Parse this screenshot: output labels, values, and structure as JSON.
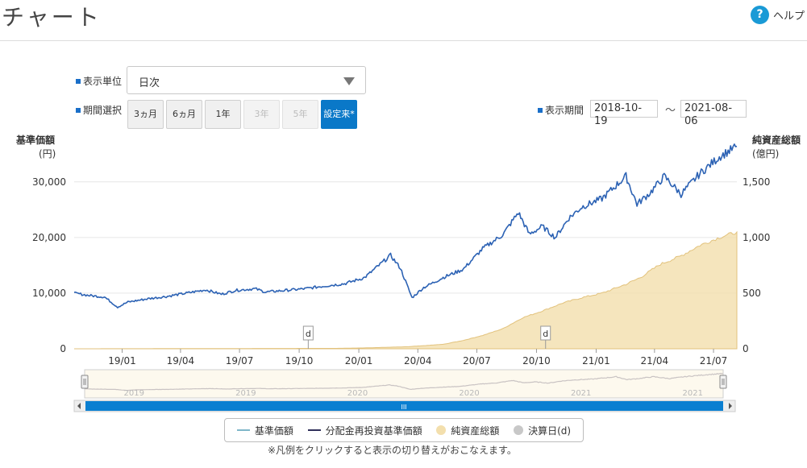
{
  "header": {
    "title": "チャート",
    "help_label": "ヘルプ",
    "help_icon": "question-icon"
  },
  "controls": {
    "unit_label": "表示単位",
    "unit_value": "日次",
    "period_label": "期間選択",
    "period_buttons": [
      {
        "label": "3ヵ月",
        "state": "enabled"
      },
      {
        "label": "6ヵ月",
        "state": "enabled"
      },
      {
        "label": "1年",
        "state": "enabled"
      },
      {
        "label": "3年",
        "state": "disabled"
      },
      {
        "label": "5年",
        "state": "disabled"
      },
      {
        "label": "設定来*",
        "state": "active"
      }
    ],
    "display_period_label": "表示期間",
    "date_from": "2018-10-19",
    "date_sep": "～",
    "date_to": "2021-08-06"
  },
  "axes": {
    "left_title": "基準価額",
    "left_unit": "(円)",
    "right_title": "純資産総額",
    "right_unit": "(億円)"
  },
  "chart_data": {
    "type": "line",
    "x_range": [
      "2018-10-19",
      "2021-08-06"
    ],
    "x_ticks": [
      "19/01",
      "19/04",
      "19/07",
      "19/10",
      "20/01",
      "20/04",
      "20/07",
      "20/10",
      "21/01",
      "21/04",
      "21/07"
    ],
    "y_left": {
      "ticks": [
        "0",
        "10,000",
        "20,000",
        "30,000"
      ],
      "range": [
        0,
        37500
      ]
    },
    "y_right": {
      "ticks": [
        "0",
        "500",
        "1,000",
        "1,500"
      ],
      "range": [
        0,
        1875
      ]
    },
    "grid": true,
    "series": [
      {
        "name": "基準価額",
        "axis": "left",
        "color": "#2c62b4",
        "points": [
          [
            "2018-10-19",
            10000
          ],
          [
            "2018-11-10",
            9600
          ],
          [
            "2018-12-05",
            9300
          ],
          [
            "2018-12-25",
            7500
          ],
          [
            "2019-01-10",
            8400
          ],
          [
            "2019-02-10",
            9000
          ],
          [
            "2019-03-10",
            9400
          ],
          [
            "2019-04-10",
            10000
          ],
          [
            "2019-05-10",
            10600
          ],
          [
            "2019-06-03",
            9800
          ],
          [
            "2019-06-25",
            10500
          ],
          [
            "2019-07-25",
            10800
          ],
          [
            "2019-08-10",
            10200
          ],
          [
            "2019-09-10",
            10500
          ],
          [
            "2019-10-10",
            10800
          ],
          [
            "2019-11-10",
            11300
          ],
          [
            "2019-12-10",
            11700
          ],
          [
            "2020-01-10",
            12800
          ],
          [
            "2020-02-19",
            16800
          ],
          [
            "2020-03-05",
            14500
          ],
          [
            "2020-03-23",
            9200
          ],
          [
            "2020-04-10",
            11000
          ],
          [
            "2020-05-10",
            12800
          ],
          [
            "2020-06-10",
            14300
          ],
          [
            "2020-07-10",
            18000
          ],
          [
            "2020-08-10",
            20500
          ],
          [
            "2020-09-03",
            24500
          ],
          [
            "2020-09-20",
            20600
          ],
          [
            "2020-10-10",
            22000
          ],
          [
            "2020-10-30",
            20000
          ],
          [
            "2020-11-20",
            23500
          ],
          [
            "2020-12-10",
            25500
          ],
          [
            "2021-01-10",
            27000
          ],
          [
            "2021-02-16",
            31000
          ],
          [
            "2021-03-05",
            26000
          ],
          [
            "2021-03-25",
            28000
          ],
          [
            "2021-04-16",
            31000
          ],
          [
            "2021-05-12",
            27800
          ],
          [
            "2021-06-10",
            31500
          ],
          [
            "2021-07-10",
            34500
          ],
          [
            "2021-08-06",
            36400
          ]
        ]
      },
      {
        "name": "分配金再投資基準価額",
        "axis": "left",
        "color": "#2f2f5a"
      },
      {
        "name": "純資産総額",
        "axis": "right",
        "type": "area",
        "color": "#f3dfad",
        "points": [
          [
            "2018-10-19",
            0
          ],
          [
            "2019-06-01",
            2
          ],
          [
            "2019-12-01",
            4
          ],
          [
            "2020-01-10",
            8
          ],
          [
            "2020-03-15",
            18
          ],
          [
            "2020-05-10",
            40
          ],
          [
            "2020-06-10",
            75
          ],
          [
            "2020-07-10",
            120
          ],
          [
            "2020-08-10",
            180
          ],
          [
            "2020-09-10",
            280
          ],
          [
            "2020-10-10",
            340
          ],
          [
            "2020-11-10",
            410
          ],
          [
            "2020-12-10",
            460
          ],
          [
            "2021-01-10",
            500
          ],
          [
            "2021-02-16",
            580
          ],
          [
            "2021-03-10",
            640
          ],
          [
            "2021-04-10",
            760
          ],
          [
            "2021-05-10",
            830
          ],
          [
            "2021-06-10",
            930
          ],
          [
            "2021-07-10",
            1000
          ],
          [
            "2021-08-06",
            1050
          ]
        ]
      }
    ],
    "settlement_markers": [
      {
        "date": "2019-10-15",
        "label": "d"
      },
      {
        "date": "2020-10-15",
        "label": "d"
      }
    ],
    "navigator": {
      "year_labels": [
        "2019",
        "2019",
        "2020",
        "2020",
        "2021",
        "2021"
      ],
      "scrollbar_grip": "III"
    }
  },
  "legend": {
    "items": [
      {
        "label": "基準価額",
        "color": "#7fb7c9",
        "marker": "line"
      },
      {
        "label": "分配金再投資基準価額",
        "color": "#2f2f5a",
        "marker": "line"
      },
      {
        "label": "純資産総額",
        "color": "#f3dfad",
        "marker": "dot"
      },
      {
        "label": "決算日(d)",
        "color": "#c8c8c8",
        "marker": "dot"
      }
    ],
    "note": "※凡例をクリックすると表示の切り替えがおこなえます。"
  }
}
